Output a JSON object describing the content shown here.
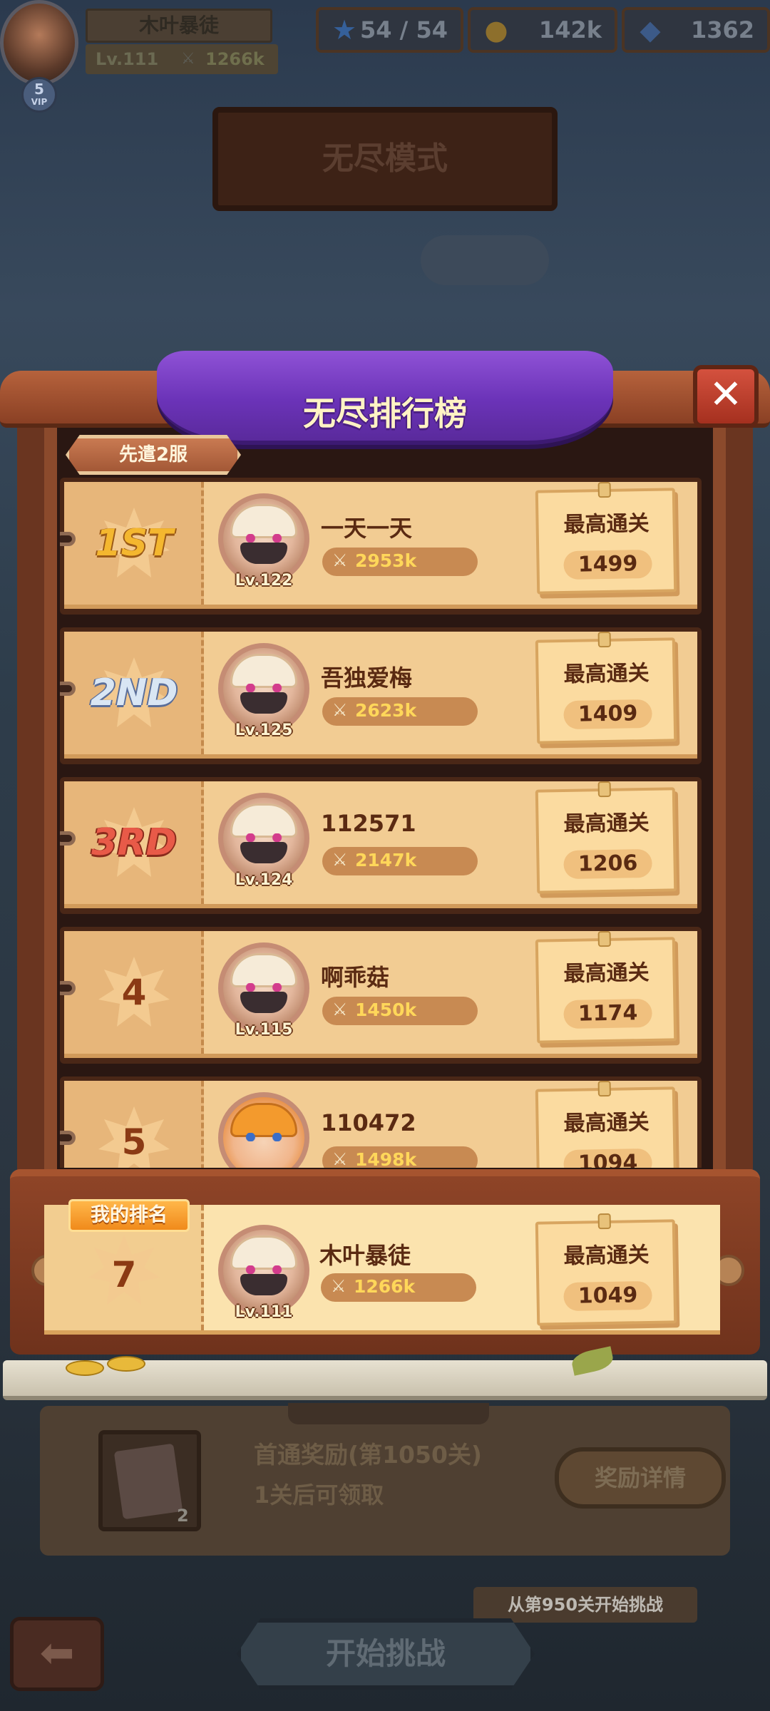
{
  "header": {
    "player_name": "木叶暴徒",
    "player_level": "Lv.111",
    "player_power": "1266k",
    "vip_level": "5",
    "vip_label": "VIP",
    "energy": "54 / 54",
    "gold": "142k",
    "gems": "1362"
  },
  "mode_title": "无尽模式",
  "leaderboard": {
    "title": "无尽排行榜",
    "server_tag": "先遣2服",
    "close_icon": "close-icon",
    "best_label": "最高通关",
    "rows": [
      {
        "rank": "1ST",
        "name": "一天一天",
        "level": "Lv.122",
        "power": "2953k",
        "best": "1499"
      },
      {
        "rank": "2ND",
        "name": "吾独爱梅",
        "level": "Lv.125",
        "power": "2623k",
        "best": "1409"
      },
      {
        "rank": "3RD",
        "name": "112571",
        "level": "Lv.124",
        "power": "2147k",
        "best": "1206"
      },
      {
        "rank": "4",
        "name": "啊乖菇",
        "level": "Lv.115",
        "power": "1450k",
        "best": "1174"
      },
      {
        "rank": "5",
        "name": "110472",
        "level": "",
        "power": "1498k",
        "best": "1094"
      }
    ],
    "my_rank": {
      "badge": "我的排名",
      "rank": "7",
      "name": "木叶暴徒",
      "level": "Lv.111",
      "power": "1266k",
      "best": "1049"
    }
  },
  "reward": {
    "line1": "首通奖励(第1050关)",
    "line2": "1关后可领取",
    "item_count": "2",
    "detail_button": "奖励详情"
  },
  "start_hint": "从第950关开始挑战",
  "start_button": "开始挑战",
  "colors": {
    "banner_purple": "#7a3fc8",
    "wood_brown": "#8b4a2c",
    "parchment": "#f2cc93",
    "power_gold": "#ffd75a",
    "close_red": "#c94333"
  }
}
